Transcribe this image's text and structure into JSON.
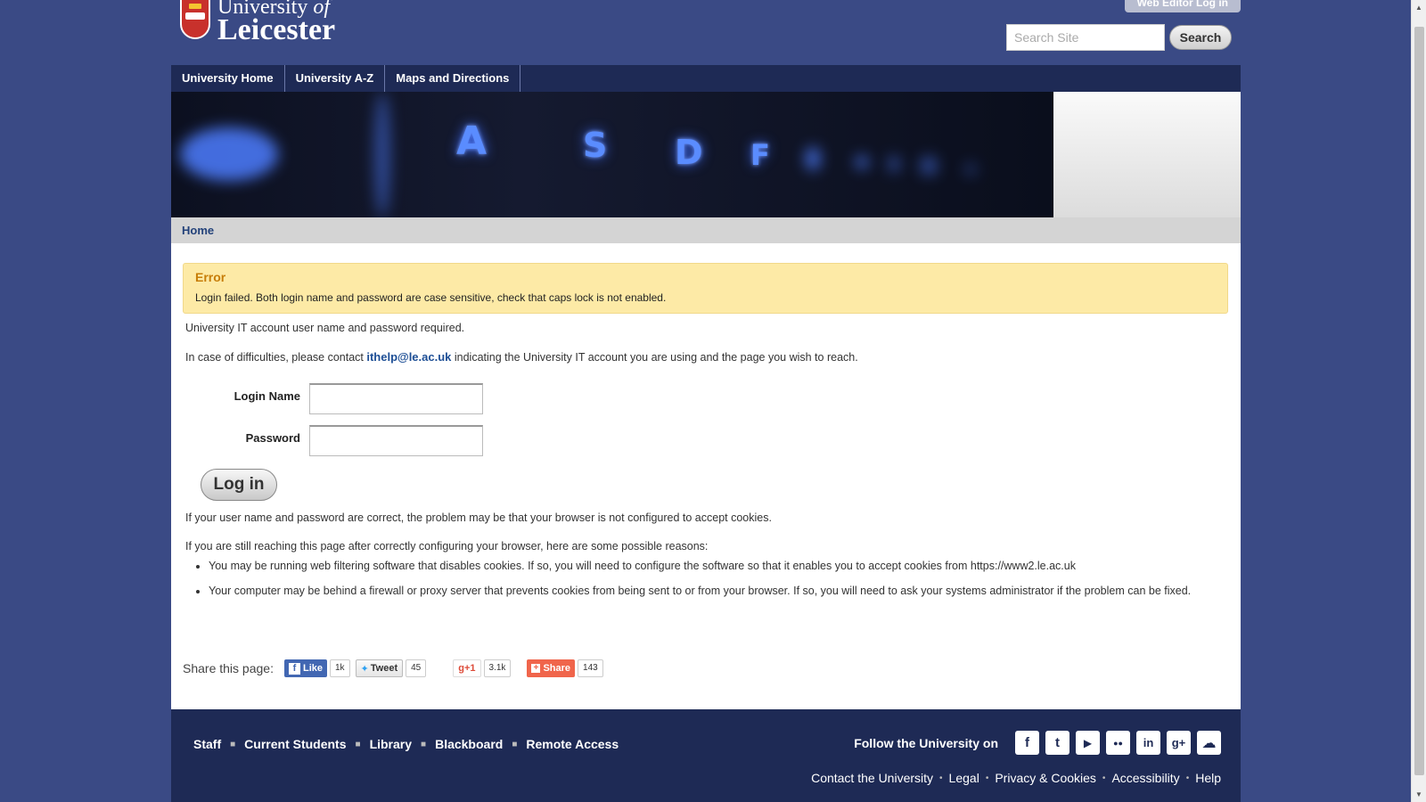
{
  "header": {
    "logo_line1": "University",
    "logo_of": "of",
    "logo_line2": "Leicester",
    "web_editor_label": "Web Editor Log in",
    "search_placeholder": "Search Site",
    "search_button": "Search"
  },
  "nav": {
    "items": [
      {
        "label": "University Home"
      },
      {
        "label": "University A-Z"
      },
      {
        "label": "Maps and Directions"
      }
    ]
  },
  "banner": {
    "keys": [
      "A",
      "S",
      "D",
      "F"
    ]
  },
  "breadcrumb": {
    "home": "Home"
  },
  "error": {
    "title": "Error",
    "message": "Login failed. Both login name and password are case sensitive, check that caps lock is not enabled."
  },
  "intro": {
    "required": "University IT account user name and password required.",
    "contact_prefix": "In case of difficulties, please contact ",
    "contact_email": "ithelp@le.ac.uk",
    "contact_suffix": " indicating the University IT account you are using and the page you wish to reach."
  },
  "form": {
    "login_name_label": "Login Name",
    "password_label": "Password",
    "login_name_value": "",
    "password_value": "",
    "login_button": "Log in"
  },
  "cookies": {
    "line1": "If your user name and password are correct, the problem may be that your browser is not configured to accept cookies.",
    "line2": "If you are still reaching this page after correctly configuring your browser, here are some possible reasons:",
    "reasons": [
      "You may be running web filtering software that disables cookies. If so, you will need to configure the software so that it enables you to accept cookies from https://www2.le.ac.uk",
      "Your computer may be behind a firewall or proxy server that prevents cookies from being sent to or from your browser. If so, you will need to ask your systems administrator if the problem can be fixed."
    ]
  },
  "share": {
    "label": "Share this page:",
    "facebook": {
      "label": "Like",
      "count": "1k"
    },
    "twitter": {
      "label": "Tweet",
      "count": "45"
    },
    "google": {
      "label": "+1",
      "count": "3.1k"
    },
    "sharethis": {
      "label": "Share",
      "count": "143"
    }
  },
  "footer": {
    "links": [
      "Staff",
      "Current Students",
      "Library",
      "Blackboard",
      "Remote Access"
    ],
    "follow_label": "Follow the University on",
    "social": [
      {
        "name": "facebook-icon",
        "glyph": "f"
      },
      {
        "name": "twitter-icon",
        "glyph": "t"
      },
      {
        "name": "youtube-icon",
        "glyph": "▶"
      },
      {
        "name": "flickr-icon",
        "glyph": "●●"
      },
      {
        "name": "linkedin-icon",
        "glyph": "in"
      },
      {
        "name": "googleplus-icon",
        "glyph": "g+"
      },
      {
        "name": "soundcloud-icon",
        "glyph": "☁"
      }
    ],
    "legal": [
      "Contact the University",
      "Legal",
      "Privacy & Cookies",
      "Accessibility",
      "Help"
    ]
  }
}
